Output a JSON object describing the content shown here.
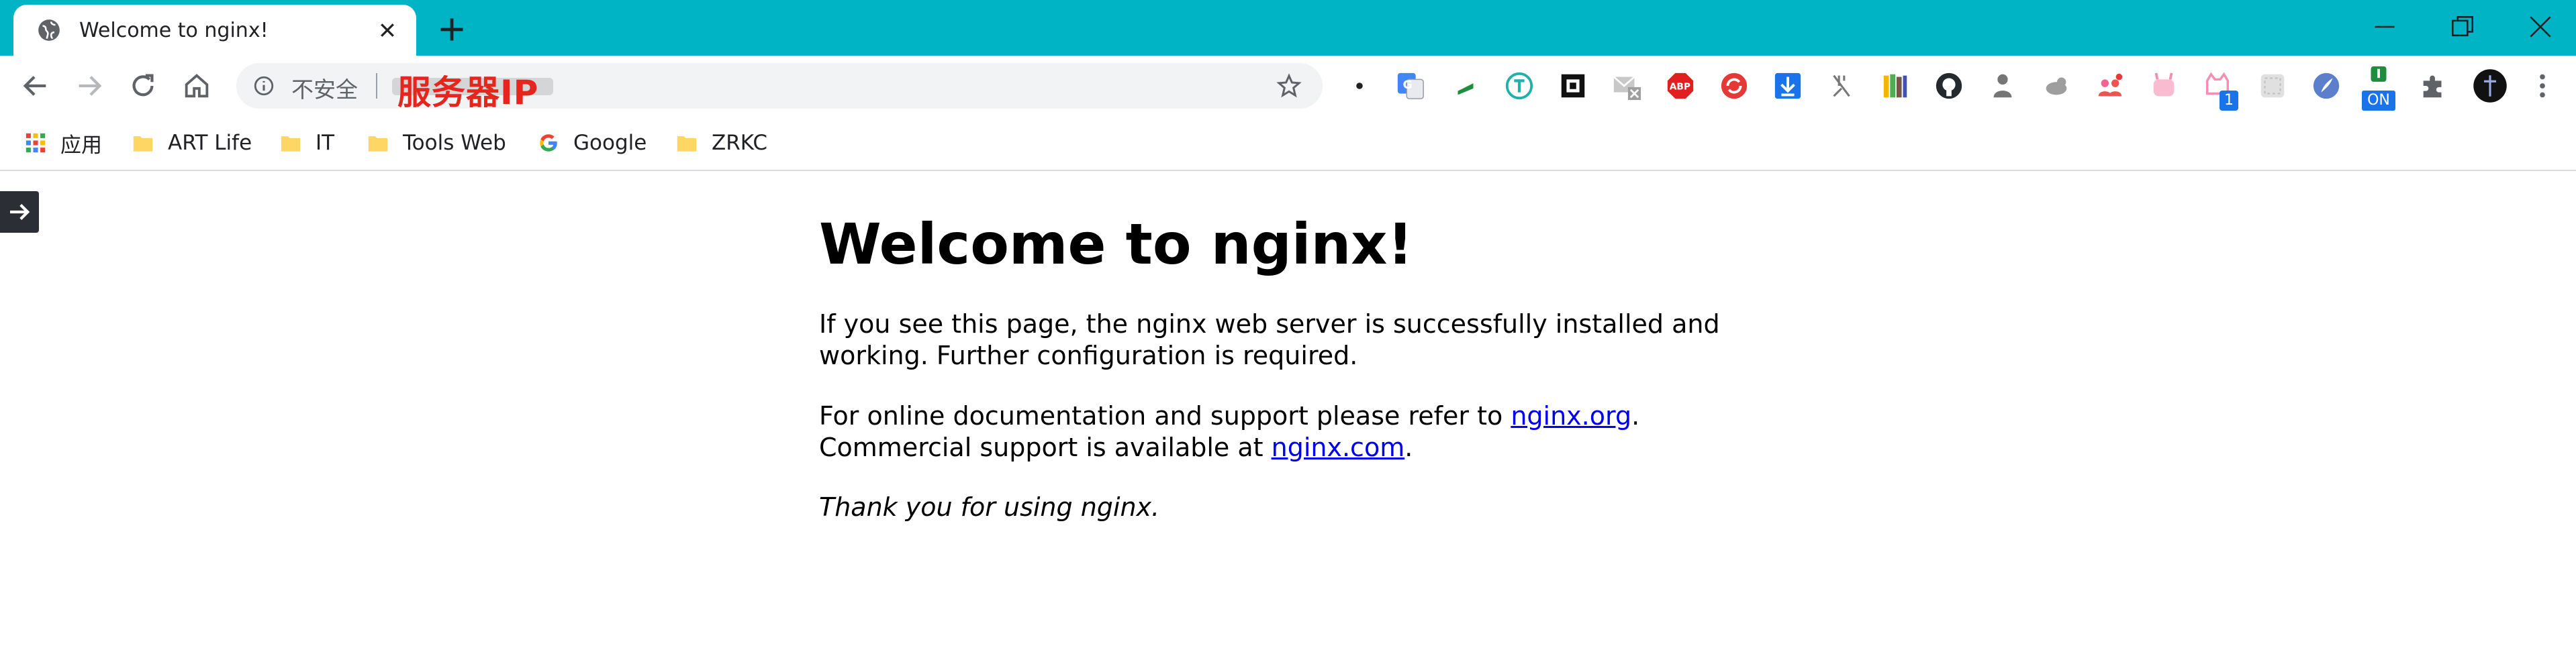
{
  "tab": {
    "title": "Welcome to nginx!"
  },
  "omnibox": {
    "security_label": "不安全",
    "url_text": "服务器IP"
  },
  "bookmarks": [
    {
      "label": "应用",
      "icon": "apps-grid-icon"
    },
    {
      "label": "ART Life",
      "icon": "folder-icon"
    },
    {
      "label": "IT",
      "icon": "folder-icon"
    },
    {
      "label": "Tools Web",
      "icon": "folder-icon"
    },
    {
      "label": "Google",
      "icon": "google-icon"
    },
    {
      "label": "ZRKC",
      "icon": "folder-icon"
    }
  ],
  "extensions": {
    "badge_count": "1",
    "badge_on": "ON"
  },
  "page": {
    "heading": "Welcome to nginx!",
    "para1_line1": "If you see this page, the nginx web server is successfully installed and",
    "para1_line2": "working. Further configuration is required.",
    "para2_line1_pre": "For online documentation and support please refer to ",
    "para2_link1": "nginx.org",
    "para2_line1_post": ".",
    "para2_line2_pre": "Commercial support is available at ",
    "para2_link2": "nginx.com",
    "para2_line2_post": ".",
    "para3": "Thank you for using nginx."
  },
  "colors": {
    "titlebar": "#00b4c5",
    "url_highlight": "#e4261f",
    "link": "#0000ee"
  }
}
